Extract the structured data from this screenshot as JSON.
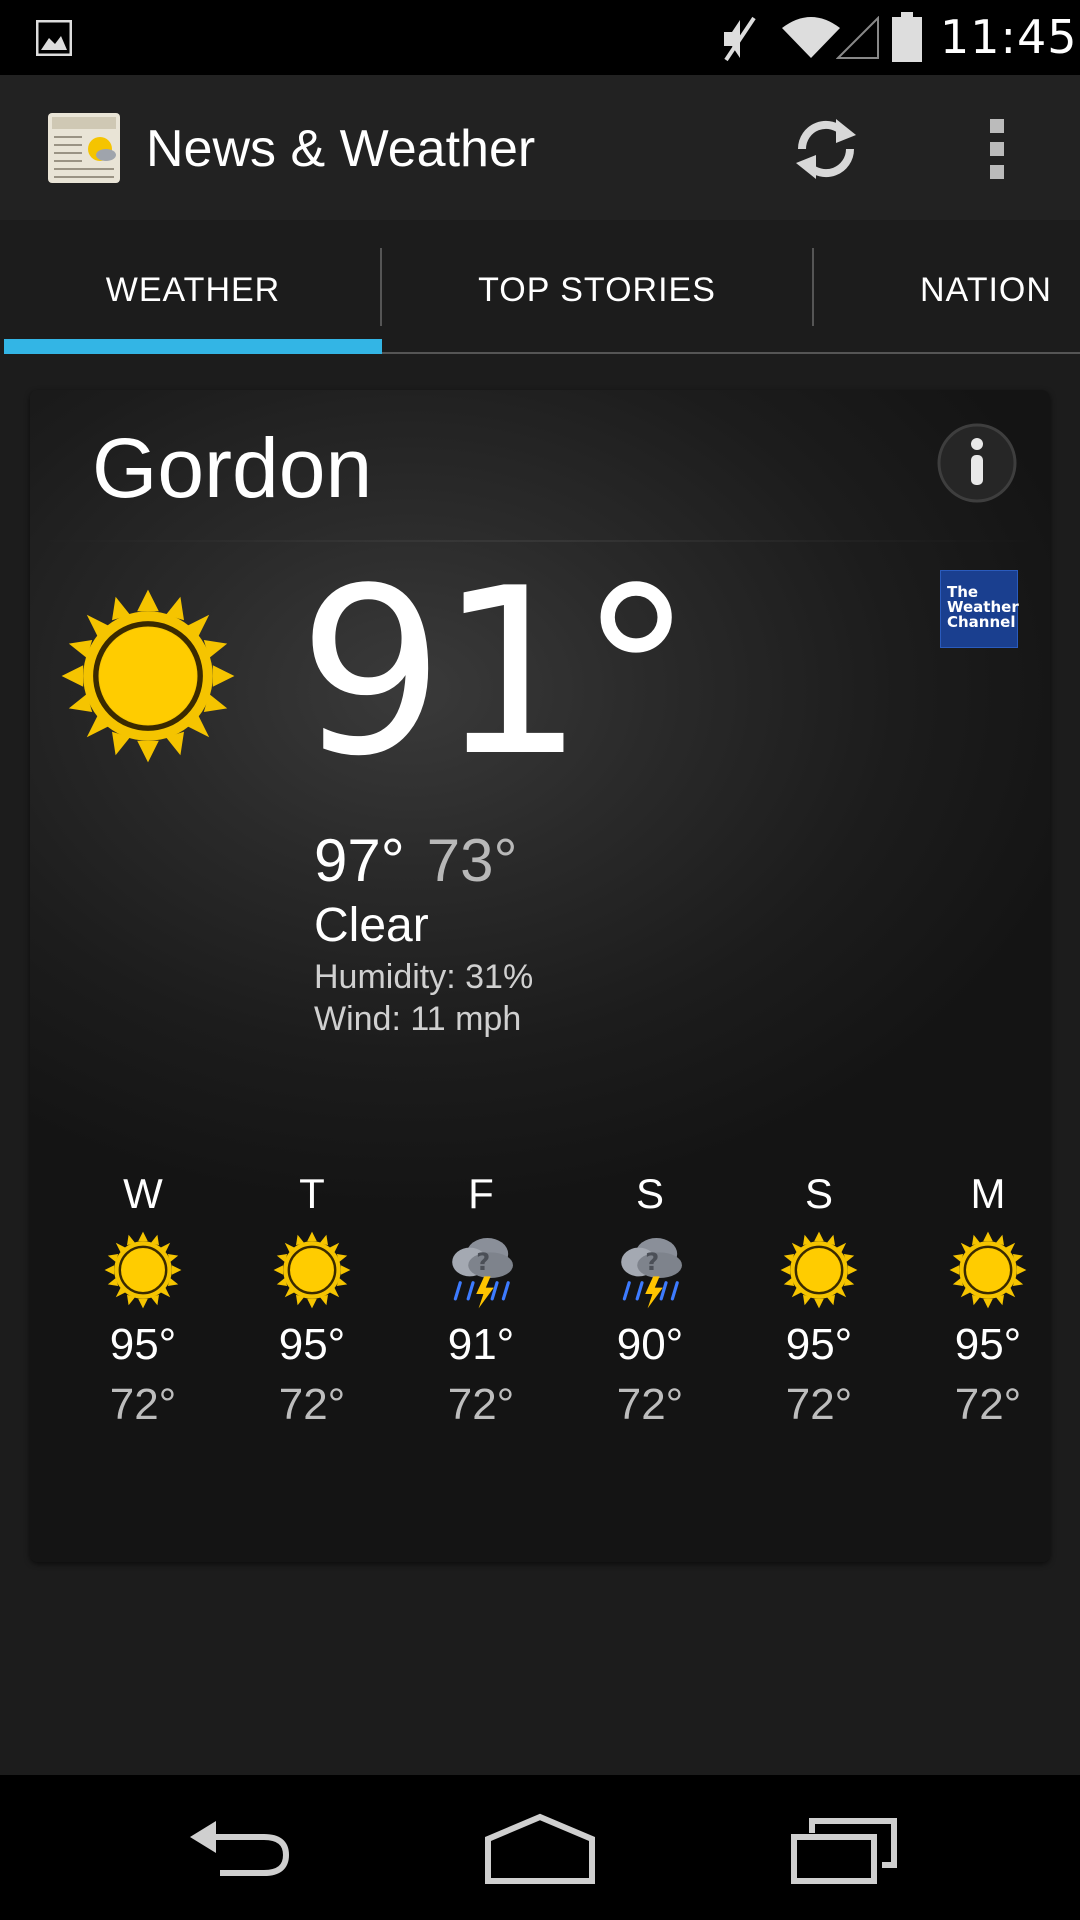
{
  "status_bar": {
    "time": "11:45",
    "icons": [
      "gallery-icon",
      "mute-icon",
      "wifi-icon",
      "signal-icon",
      "battery-icon"
    ]
  },
  "action_bar": {
    "title": "News & Weather",
    "icons": [
      "app-icon",
      "refresh-icon",
      "overflow-menu-icon"
    ]
  },
  "tabs": [
    {
      "label": "WEATHER",
      "selected": true
    },
    {
      "label": "TOP STORIES",
      "selected": false
    },
    {
      "label": "NATION",
      "selected": false
    }
  ],
  "accent_color": "#33b5e5",
  "weather": {
    "city": "Gordon",
    "current_temp": "91°",
    "high": "97°",
    "low": "73°",
    "condition": "Clear",
    "humidity": "Humidity: 31%",
    "wind": "Wind: 11 mph",
    "provider_logo_text": [
      "The",
      "Weather",
      "Channel"
    ],
    "current_icon": "sun-icon",
    "forecast": [
      {
        "day": "W",
        "icon": "sun-icon",
        "high": "95°",
        "low": "72°"
      },
      {
        "day": "T",
        "icon": "sun-icon",
        "high": "95°",
        "low": "72°"
      },
      {
        "day": "F",
        "icon": "thunderstorm-icon",
        "high": "91°",
        "low": "72°"
      },
      {
        "day": "S",
        "icon": "thunderstorm-icon",
        "high": "90°",
        "low": "72°"
      },
      {
        "day": "S",
        "icon": "sun-icon",
        "high": "95°",
        "low": "72°"
      },
      {
        "day": "M",
        "icon": "sun-icon",
        "high": "95°",
        "low": "72°"
      }
    ]
  },
  "nav_bar": {
    "icons": [
      "back-icon",
      "home-icon",
      "recents-icon"
    ]
  }
}
